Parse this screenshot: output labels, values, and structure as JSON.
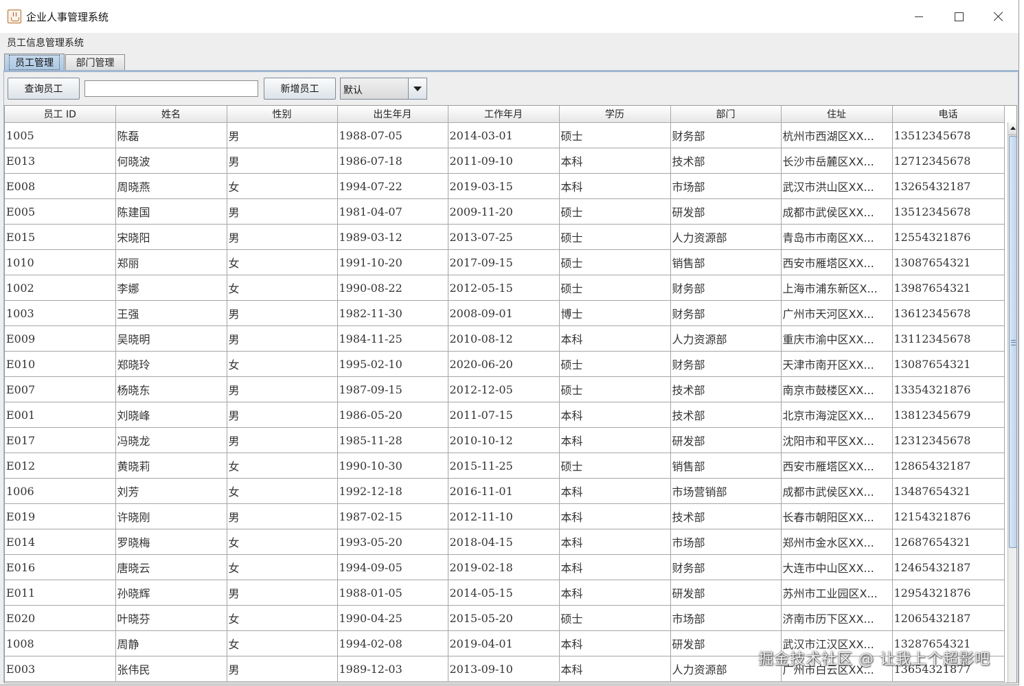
{
  "window": {
    "title": "企业人事管理系统",
    "icon": "java-cup-icon"
  },
  "app": {
    "system_label": "员工信息管理系统"
  },
  "tabs": [
    {
      "label": "员工管理",
      "active": true
    },
    {
      "label": "部门管理",
      "active": false
    }
  ],
  "toolbar": {
    "query_label": "查询员工",
    "search_value": "",
    "add_label": "新增员工",
    "sort_selected": "默认"
  },
  "table": {
    "columns": [
      "员工 ID",
      "姓名",
      "性别",
      "出生年月",
      "工作年月",
      "学历",
      "部门",
      "住址",
      "电话"
    ],
    "rows": [
      [
        "1005",
        "陈磊",
        "男",
        "1988-07-05",
        "2014-03-01",
        "硕士",
        "财务部",
        "杭州市西湖区XX...",
        "13512345678"
      ],
      [
        "E013",
        "何晓波",
        "男",
        "1986-07-18",
        "2011-09-10",
        "本科",
        "技术部",
        "长沙市岳麓区XX...",
        "12712345678"
      ],
      [
        "E008",
        "周晓燕",
        "女",
        "1994-07-22",
        "2019-03-15",
        "本科",
        "市场部",
        "武汉市洪山区XX...",
        "13265432187"
      ],
      [
        "E005",
        "陈建国",
        "男",
        "1981-04-07",
        "2009-11-20",
        "硕士",
        "研发部",
        "成都市武侯区XX...",
        "13512345678"
      ],
      [
        "E015",
        "宋晓阳",
        "男",
        "1989-03-12",
        "2013-07-25",
        "硕士",
        "人力资源部",
        "青岛市市南区XX...",
        "12554321876"
      ],
      [
        "1010",
        "郑丽",
        "女",
        "1991-10-20",
        "2017-09-15",
        "硕士",
        "销售部",
        "西安市雁塔区XX...",
        "13087654321"
      ],
      [
        "1002",
        "李娜",
        "女",
        "1990-08-22",
        "2012-05-15",
        "硕士",
        "财务部",
        "上海市浦东新区X...",
        "13987654321"
      ],
      [
        "1003",
        "王强",
        "男",
        "1982-11-30",
        "2008-09-01",
        "博士",
        "财务部",
        "广州市天河区XX...",
        "13612345678"
      ],
      [
        "E009",
        "吴晓明",
        "男",
        "1984-11-25",
        "2010-08-12",
        "本科",
        "人力资源部",
        "重庆市渝中区XX...",
        "13112345678"
      ],
      [
        "E010",
        "郑晓玲",
        "女",
        "1995-02-10",
        "2020-06-20",
        "硕士",
        "财务部",
        "天津市南开区XX...",
        "13087654321"
      ],
      [
        "E007",
        "杨晓东",
        "男",
        "1987-09-15",
        "2012-12-05",
        "硕士",
        "技术部",
        "南京市鼓楼区XX...",
        "13354321876"
      ],
      [
        "E001",
        "刘晓峰",
        "男",
        "1986-05-20",
        "2011-07-15",
        "本科",
        "技术部",
        "北京市海淀区XX...",
        "13812345679"
      ],
      [
        "E017",
        "冯晓龙",
        "男",
        "1985-11-28",
        "2010-10-12",
        "本科",
        "研发部",
        "沈阳市和平区XX...",
        "12312345678"
      ],
      [
        "E012",
        "黄晓莉",
        "女",
        "1990-10-30",
        "2015-11-25",
        "硕士",
        "销售部",
        "西安市雁塔区XX...",
        "12865432187"
      ],
      [
        "1006",
        "刘芳",
        "女",
        "1992-12-18",
        "2016-11-01",
        "本科",
        "市场营销部",
        "成都市武侯区XX...",
        "13487654321"
      ],
      [
        "E019",
        "许晓刚",
        "男",
        "1987-02-15",
        "2012-11-10",
        "本科",
        "技术部",
        "长春市朝阳区XX...",
        "12154321876"
      ],
      [
        "E014",
        "罗晓梅",
        "女",
        "1993-05-20",
        "2018-04-15",
        "本科",
        "市场部",
        "郑州市金水区XX...",
        "12687654321"
      ],
      [
        "E016",
        "唐晓云",
        "女",
        "1994-09-05",
        "2019-02-18",
        "本科",
        "财务部",
        "大连市中山区XX...",
        "12465432187"
      ],
      [
        "E011",
        "孙晓辉",
        "男",
        "1988-01-05",
        "2014-05-15",
        "本科",
        "研发部",
        "苏州市工业园区X...",
        "12954321876"
      ],
      [
        "E020",
        "叶晓芬",
        "女",
        "1990-04-25",
        "2015-05-20",
        "硕士",
        "市场部",
        "济南市历下区XX...",
        "12065432187"
      ],
      [
        "1008",
        "周静",
        "女",
        "1994-02-08",
        "2019-04-01",
        "本科",
        "研发部",
        "武汉市江汉区XX...",
        "13287654321"
      ],
      [
        "E003",
        "张伟民",
        "男",
        "1989-12-03",
        "2013-09-10",
        "本科",
        "人力资源部",
        "广州市白云区XX...",
        "13654321877"
      ]
    ]
  },
  "watermark": "掘金技术社区 @ 让我上个超影吧"
}
